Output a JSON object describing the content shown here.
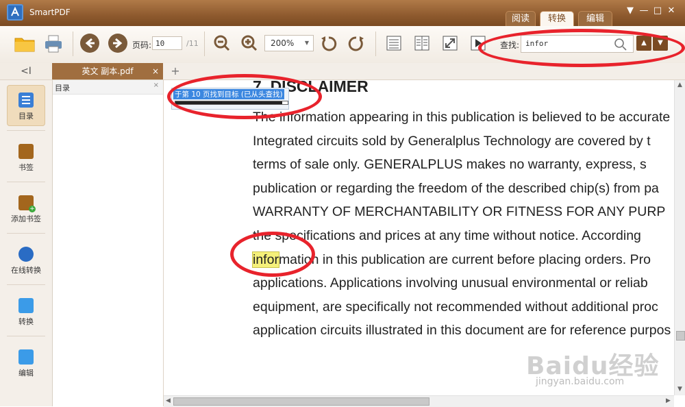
{
  "app": {
    "title": "SmartPDF"
  },
  "mode_tabs": [
    "阅读",
    "转换",
    "编辑"
  ],
  "mode_active": "转换",
  "window_controls": [
    "filter",
    "minimize",
    "maximize",
    "close"
  ],
  "toolbar": {
    "page_label": "页码:",
    "page_value": "10",
    "page_total": "/11",
    "zoom_value": "200%",
    "search_label": "查找:",
    "search_value": "infor"
  },
  "sidebar": {
    "collapse_glyph": "<I",
    "items": [
      {
        "label": "目录",
        "icon": "toc-icon",
        "active": true
      },
      {
        "label": "书签",
        "icon": "bookmark-icon"
      },
      {
        "label": "添加书签",
        "icon": "add-bookmark-icon"
      },
      {
        "label": "在线转换",
        "icon": "online-convert-icon"
      },
      {
        "label": "转换",
        "icon": "convert-icon"
      },
      {
        "label": "编辑",
        "icon": "edit-icon"
      }
    ]
  },
  "tabs": {
    "doc_name": "英文 副本.pdf",
    "close_glyph": "×",
    "add_glyph": "+"
  },
  "toc": {
    "title": "目录",
    "close_glyph": "×"
  },
  "search_status": {
    "text": "于第 10 页找到目标 (已从头查找)",
    "progress": 0.95
  },
  "document": {
    "heading": "7. DISCLAIMER",
    "lines": [
      "The information appearing in this publication is believed to be accurate",
      "Integrated circuits sold by Generalplus Technology are covered by t",
      "terms of sale only.  GENERALPLUS makes no warranty, express, s",
      "publication or regarding the freedom of the described chip(s) from pa",
      "WARRANTY OF MERCHANTABILITY OR FITNESS FOR ANY PURP",
      "the specifications and prices at any time without notice.  According",
      "information in this publication are current before placing orders.  Pro",
      "applications.  Applications involving unusual environmental or reliab",
      "equipment, are specifically not recommended without additional proc",
      "application circuits illustrated in this document are for reference purpos"
    ],
    "match_text": "infor",
    "match_rest": "mation in this publication are current before placing orders.  Pro"
  },
  "watermark": {
    "main": "Baidu经验",
    "sub": "jingyan.baidu.com"
  },
  "colors": {
    "title_bar": "#8e5a2e",
    "highlight": "#f5f07a",
    "annotation": "#e8232c",
    "accent": "#3b87e0"
  }
}
